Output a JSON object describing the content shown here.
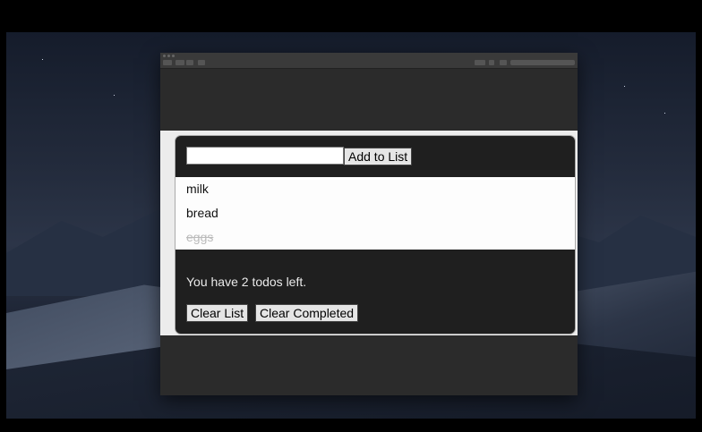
{
  "app": {
    "add_button_label": "Add to List",
    "input_value": "",
    "items": [
      {
        "text": "milk",
        "completed": false
      },
      {
        "text": "bread",
        "completed": false
      },
      {
        "text": "eggs",
        "completed": true
      }
    ],
    "status_text": "You have 2 todos left.",
    "clear_list_label": "Clear List",
    "clear_completed_label": "Clear Completed"
  },
  "colors": {
    "panel_background": "#1f1f1f",
    "list_background": "#fdfdfd",
    "completed_text": "#bbbbbb"
  }
}
